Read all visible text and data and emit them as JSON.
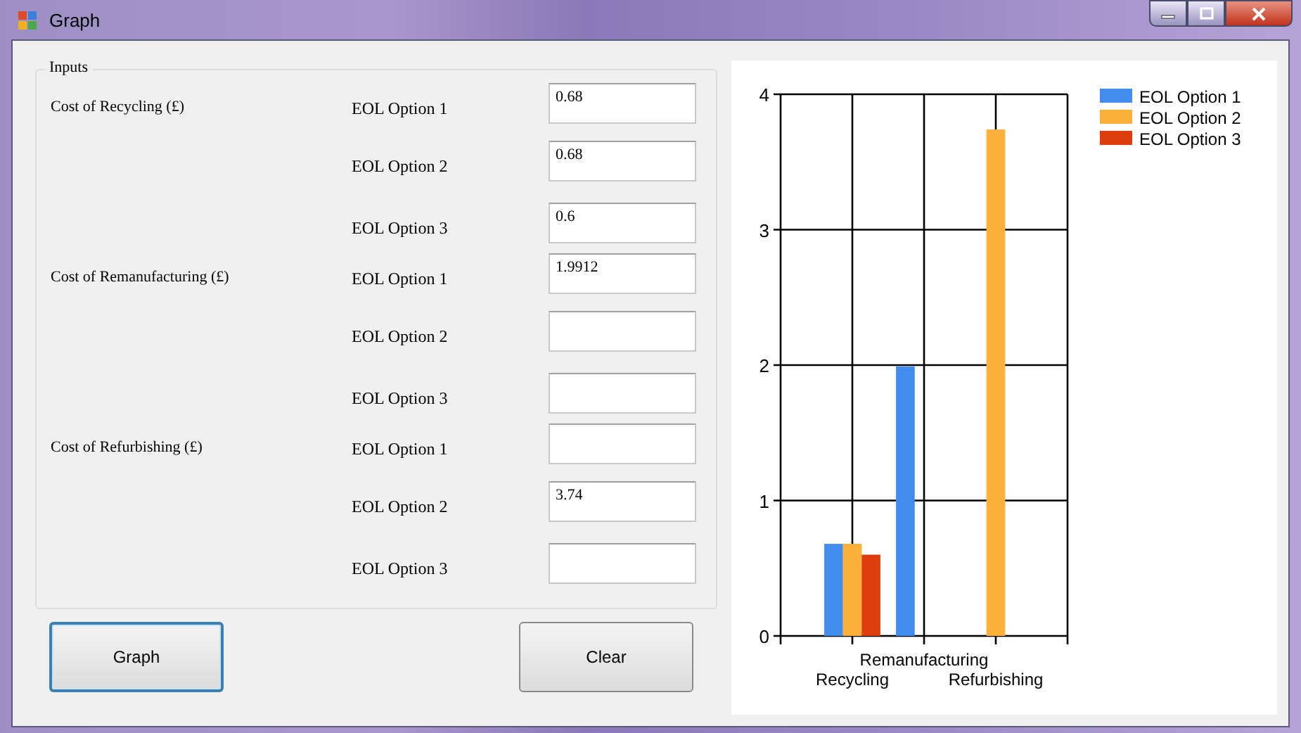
{
  "window": {
    "title": "Graph"
  },
  "inputs": {
    "title": "Inputs",
    "groups": [
      {
        "label": "Cost of Recycling (£)",
        "fields": [
          {
            "label": "EOL Option 1",
            "value": "0.68"
          },
          {
            "label": "EOL Option 2",
            "value": "0.68"
          },
          {
            "label": "EOL Option 3",
            "value": "0.6"
          }
        ]
      },
      {
        "label": "Cost of Remanufacturing (£)",
        "fields": [
          {
            "label": "EOL Option 1",
            "value": "1.9912"
          },
          {
            "label": "EOL Option 2"
          },
          {
            "label": "EOL Option 3"
          }
        ]
      },
      {
        "label": "Cost of Refurbishing (£)",
        "fields": [
          {
            "label": "EOL Option 1"
          },
          {
            "label": "EOL Option 2",
            "value": "3.74"
          },
          {
            "label": "EOL Option 3"
          }
        ]
      }
    ]
  },
  "buttons": [
    {
      "label": "Graph",
      "focused": true
    },
    {
      "label": "Clear",
      "focused": false
    }
  ],
  "chart": {
    "chart_data": {
      "type": "bar",
      "categories": [
        "Recycling",
        "Remanufacturing",
        "Refurbishing"
      ],
      "ylim": [
        0,
        4
      ],
      "grid": true,
      "legend": true,
      "yticks": [
        0,
        1,
        2,
        3,
        4
      ],
      "series": [
        {
          "name": "EOL Option 1",
          "color": "#428ced",
          "values": [
            0.68,
            1.99,
            null
          ]
        },
        {
          "name": "EOL Option 2",
          "color": "#fbb03c",
          "values": [
            0.68,
            null,
            3.74
          ]
        },
        {
          "name": "EOL Option 3",
          "color": "#de3e0e",
          "values": [
            0.6,
            null,
            null
          ]
        }
      ]
    }
  }
}
